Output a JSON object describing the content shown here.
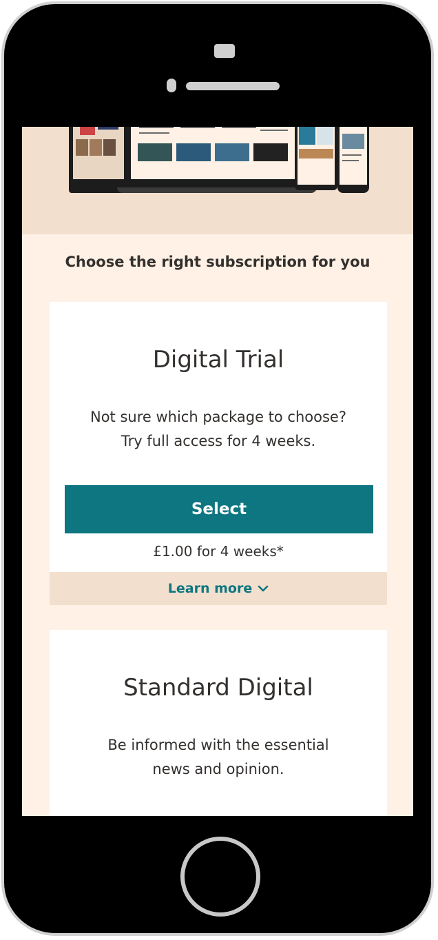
{
  "section": {
    "title": "Choose the right subscription for you"
  },
  "cards": [
    {
      "title": "Digital Trial",
      "description_line1": "Not sure which package to choose?",
      "description_line2": "Try full access for 4 weeks.",
      "button_label": "Select",
      "price": "£1.00 for 4 weeks*",
      "learn_more_label": "Learn more"
    },
    {
      "title": "Standard Digital",
      "description_line1": "Be informed with the essential",
      "description_line2": "news and opinion."
    }
  ],
  "colors": {
    "accent": "#0d7680",
    "page_background": "#fff1e5",
    "hero_background": "#f2dfce",
    "text": "#33302e"
  },
  "icons": {
    "learn_more_chevron": "chevron-down-icon",
    "home_button": "home-button-icon"
  }
}
